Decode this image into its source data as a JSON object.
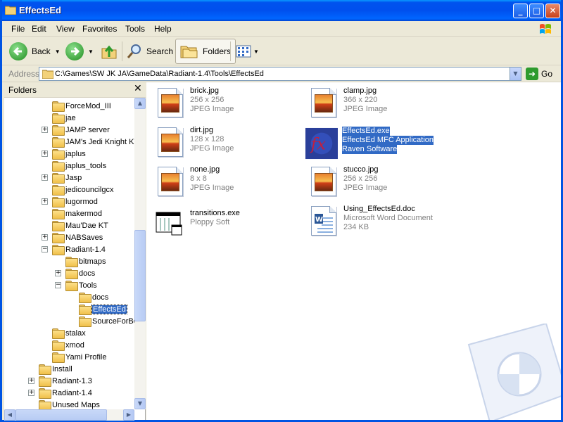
{
  "window": {
    "title": "EffectsEd"
  },
  "titlebar_buttons": {
    "minimize": "_",
    "maximize": "□",
    "close": "✕"
  },
  "menu": [
    "File",
    "Edit",
    "View",
    "Favorites",
    "Tools",
    "Help"
  ],
  "toolbar": {
    "back": "Back",
    "search": "Search",
    "folders": "Folders"
  },
  "address": {
    "label": "Address",
    "path": "C:\\Games\\SW JK JA\\GameData\\Radiant-1.4\\Tools\\EffectsEd",
    "go": "Go"
  },
  "folders_pane": {
    "title": "Folders",
    "close": "✕",
    "tree": [
      {
        "label": "ForceMod_III",
        "expander": ""
      },
      {
        "label": "jae",
        "expander": ""
      },
      {
        "label": "JAMP server",
        "expander": "+"
      },
      {
        "label": "JAM's Jedi Knight KT",
        "expander": ""
      },
      {
        "label": "japlus",
        "expander": "+"
      },
      {
        "label": "japlus_tools",
        "expander": ""
      },
      {
        "label": "Jasp",
        "expander": "+"
      },
      {
        "label": "jedicouncilgcx",
        "expander": ""
      },
      {
        "label": "lugormod",
        "expander": "+"
      },
      {
        "label": "makermod",
        "expander": ""
      },
      {
        "label": "Mau'Dae KT",
        "expander": ""
      },
      {
        "label": "NABSaves",
        "expander": "+"
      },
      {
        "label": "Radiant-1.4",
        "expander": "−"
      },
      {
        "label": "bitmaps",
        "expander": ""
      },
      {
        "label": "docs",
        "expander": "+"
      },
      {
        "label": "Tools",
        "expander": "−"
      },
      {
        "label": "docs",
        "expander": ""
      },
      {
        "label": "EffectsEd",
        "expander": ""
      },
      {
        "label": "SourceForBe",
        "expander": ""
      },
      {
        "label": "stalax",
        "expander": ""
      },
      {
        "label": "xmod",
        "expander": ""
      },
      {
        "label": "Yami Profile",
        "expander": ""
      },
      {
        "label": "Install",
        "expander": ""
      },
      {
        "label": "Radiant-1.3",
        "expander": "+"
      },
      {
        "label": "Radiant-1.4",
        "expander": "+"
      },
      {
        "label": "Unused Maps",
        "expander": ""
      }
    ]
  },
  "files": [
    {
      "name": "brick.jpg",
      "line2": "256 x 256",
      "line3": "JPEG Image",
      "icon": "jpeg-icon"
    },
    {
      "name": "clamp.jpg",
      "line2": "366 x 220",
      "line3": "JPEG Image",
      "icon": "jpeg-icon"
    },
    {
      "name": "dirt.jpg",
      "line2": "128 x 128",
      "line3": "JPEG Image",
      "icon": "jpeg-icon"
    },
    {
      "name": "EffectsEd.exe",
      "line2": "EffectsEd MFC Application",
      "line3": "Raven Software",
      "icon": "fx-app-icon"
    },
    {
      "name": "none.jpg",
      "line2": "8 x 8",
      "line3": "JPEG Image",
      "icon": "jpeg-icon"
    },
    {
      "name": "stucco.jpg",
      "line2": "256 x 256",
      "line3": "JPEG Image",
      "icon": "jpeg-icon"
    },
    {
      "name": "transitions.exe",
      "line2": "Ploppy Soft",
      "line3": "",
      "icon": "window-app-icon"
    },
    {
      "name": "Using_EffectsEd.doc",
      "line2": "Microsoft Word Document",
      "line3": "234 KB",
      "icon": "word-doc-icon"
    }
  ],
  "colors": {
    "titlebar": "#0054e3",
    "selection": "#316ac5",
    "chrome": "#ece9d8"
  }
}
